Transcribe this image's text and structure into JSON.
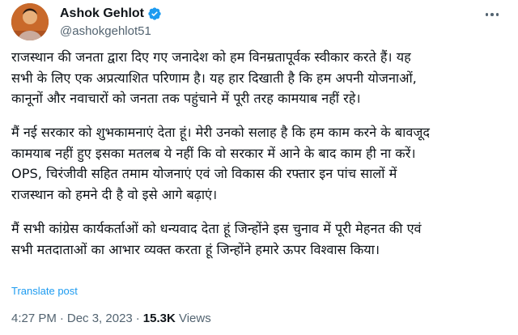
{
  "author": {
    "display_name": "Ashok Gehlot",
    "handle": "@ashokgehlot51",
    "verified_icon": "verified-badge-icon",
    "verified_color": "#1d9bf0"
  },
  "tweet": {
    "paragraphs": [
      {
        "lines": [
          "राजस्थान की जनता द्वारा दिए गए जनादेश को हम विनम्रतापूर्वक स्वीकार करते हैं। यह",
          "सभी के लिए एक अप्रत्याशित परिणाम है। यह हार दिखाती है कि हम अपनी योजनाओं,",
          "कानूनों और नवाचारों को जनता तक पहुंचाने में पूरी तरह कामयाब नहीं रहे।"
        ]
      },
      {
        "lines": [
          "मैं नई सरकार को शुभकामनाएं देता हूं। मेरी उनको सलाह है कि हम काम करने के बावजूद",
          "कामयाब नहीं हुए इसका मतलब ये नहीं कि वो सरकार में आने के बाद काम ही ना करें।",
          "OPS, चिरंजीवी सहित तमाम योजनाएं एवं जो विकास की रफ्तार इन पांच सालों में",
          "राजस्थान को हमने दी है वो इसे आगे बढ़ाएं।"
        ]
      },
      {
        "lines": [
          "मैं सभी कांग्रेस कार्यकर्ताओं को धन्यवाद देता हूं जिन्होंने इस चुनाव में पूरी मेहनत की एवं",
          "सभी मतदाताओं का आभार व्यक्त करता हूं जिन्होंने हमारे ऊपर विश्वास किया।"
        ]
      }
    ],
    "translate_label": "Translate post",
    "time": "4:27 PM",
    "date": "Dec 3, 2023",
    "separator": "·",
    "views_count": "15.3K",
    "views_label": "Views"
  },
  "colors": {
    "text": "#0f1419",
    "secondary": "#536471",
    "accent": "#1d9bf0"
  }
}
